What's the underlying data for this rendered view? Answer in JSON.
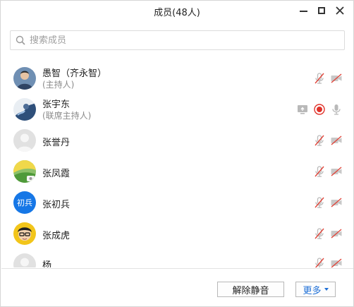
{
  "window": {
    "title": "成员(48人)"
  },
  "search": {
    "placeholder": "搜索成员"
  },
  "members": [
    {
      "name": "愚智（齐永智）",
      "role": "(主持人)",
      "mic": "muted",
      "camera": "off"
    },
    {
      "name": "张宇东",
      "role": "(联席主持人)",
      "screen_share": true,
      "recording": true,
      "mic": "on"
    },
    {
      "name": "张誉丹",
      "role": "",
      "mic": "muted",
      "camera": "off"
    },
    {
      "name": "张凤霞",
      "role": "",
      "mic": "muted",
      "camera": "off"
    },
    {
      "name": "张初兵",
      "role": "",
      "avatar_text": "初兵",
      "mic": "muted",
      "camera": "off"
    },
    {
      "name": "张成虎",
      "role": "",
      "mic": "muted",
      "camera": "off"
    },
    {
      "name": "杨",
      "role": "",
      "mic": "muted",
      "camera": "off"
    }
  ],
  "footer": {
    "unmute_label": "解除静音",
    "more_label": "更多"
  },
  "colors": {
    "accent": "#1e6fd6",
    "muted_red": "#e0453a",
    "record_red": "#e0322a",
    "icon_gray": "#b9b9b9"
  }
}
